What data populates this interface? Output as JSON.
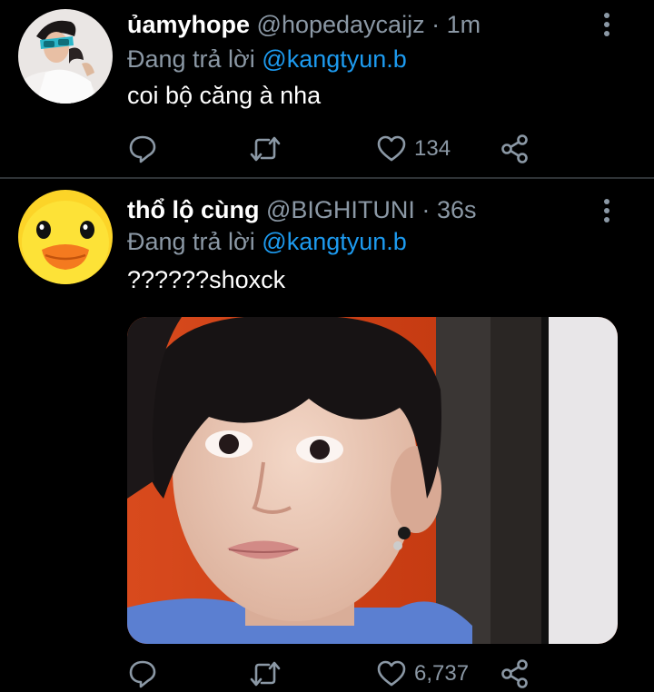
{
  "tweets": [
    {
      "display_name": "ủamyhope",
      "handle": "@hopedaycaijz",
      "separator": "·",
      "time": "1m",
      "reply_prefix": "Đang trả lời",
      "reply_to": "@kangtyun.b",
      "text": "coi bộ căng à nha",
      "likes": "134",
      "avatar_icon": "user-avatar-sunglasses",
      "has_media": false
    },
    {
      "display_name": "thổ lộ cùng",
      "handle": "@BIGHITUNI",
      "separator": "·",
      "time": "36s",
      "reply_prefix": "Đang trả lời",
      "reply_to": "@kangtyun.b",
      "text": "??????shoxck",
      "likes": "6,737",
      "avatar_icon": "user-avatar-yellow-duck",
      "has_media": true,
      "media_icon": "photo-surprised-face"
    }
  ],
  "icons": {
    "reply": "reply-icon",
    "retweet": "retweet-icon",
    "like": "heart-icon",
    "share": "share-icon",
    "more": "more-vertical-icon"
  },
  "colors": {
    "background": "#000000",
    "primary_text": "#ffffff",
    "secondary_text": "#8b98a5",
    "accent": "#1d9bf0",
    "divider": "#2f3336"
  }
}
